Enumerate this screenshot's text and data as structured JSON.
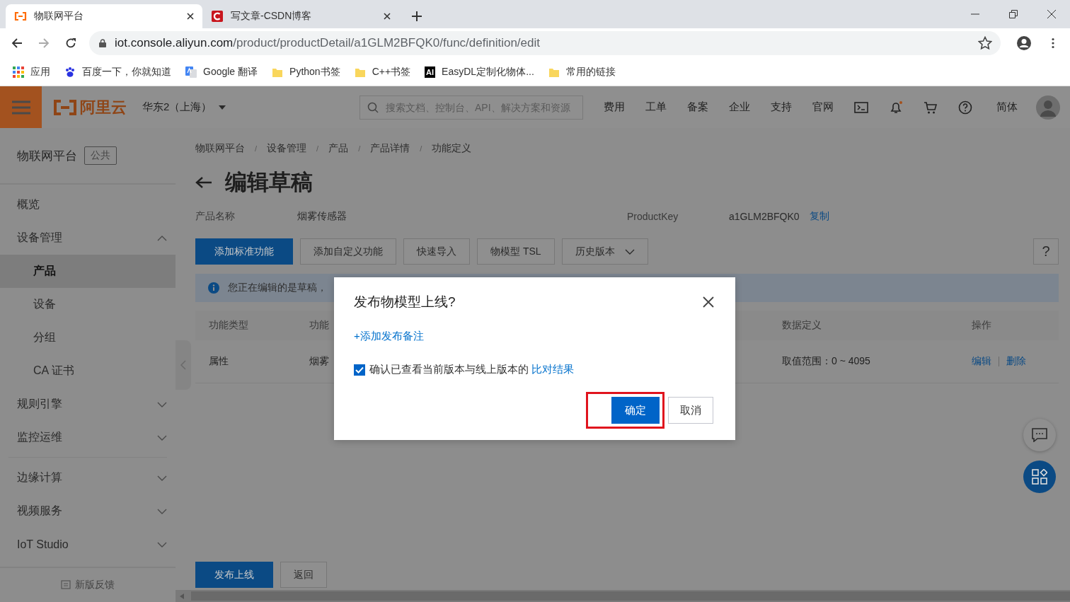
{
  "browser": {
    "tabs": [
      {
        "title": "物联网平台",
        "kind": "aliyun",
        "selected": true
      },
      {
        "title": "写文章-CSDN博客",
        "kind": "csdn",
        "selected": false
      }
    ],
    "url_host": "iot.console.aliyun.com",
    "url_path": "/product/productDetail/a1GLM2BFQK0/func/definition/edit",
    "bookmarks": [
      {
        "label": "应用",
        "kind": "apps"
      },
      {
        "label": "百度一下，你就知道",
        "kind": "paw"
      },
      {
        "label": "Google 翻译",
        "kind": "translate"
      },
      {
        "label": "Python书签",
        "kind": "folder"
      },
      {
        "label": "C++书签",
        "kind": "folder"
      },
      {
        "label": "EasyDL定制化物体...",
        "kind": "badge",
        "icon_text": "AI"
      },
      {
        "label": "常用的链接",
        "kind": "folder"
      }
    ]
  },
  "header": {
    "logo_text": "阿里云",
    "region": "华东2（上海）",
    "search_placeholder": "搜索文档、控制台、API、解决方案和资源",
    "nav": [
      "费用",
      "工单",
      "备案",
      "企业",
      "支持",
      "官网"
    ],
    "notifications_unread": true,
    "language": "简体"
  },
  "sidebar": {
    "title": "物联网平台",
    "tag": "公共",
    "items": [
      {
        "label": "概览",
        "selected": false
      },
      {
        "label": "设备管理",
        "selected": false,
        "expanded": true,
        "children": [
          {
            "label": "产品",
            "selected": true
          },
          {
            "label": "设备",
            "selected": false
          },
          {
            "label": "分组",
            "selected": false
          },
          {
            "label": "CA 证书",
            "selected": false
          }
        ]
      },
      {
        "label": "规则引擎",
        "selected": false,
        "expanded": false
      },
      {
        "label": "监控运维",
        "selected": false,
        "expanded": false
      },
      {
        "label": "边缘计算",
        "selected": false,
        "expanded": false
      },
      {
        "label": "视频服务",
        "selected": false,
        "expanded": false
      },
      {
        "label": "IoT Studio",
        "selected": false,
        "expanded": false
      }
    ],
    "feedback": "新版反馈"
  },
  "main": {
    "breadcrumb": [
      {
        "label": "物联网平台"
      },
      {
        "separator": "/",
        "label": "设备管理"
      },
      {
        "separator": "/",
        "label": "产品"
      },
      {
        "separator": "/",
        "label": "产品详情"
      },
      {
        "separator": "/",
        "label": "功能定义"
      }
    ],
    "title": "编辑草稿",
    "info": [
      {
        "label": "产品名称",
        "value": "烟雾传感器"
      },
      {
        "label": "ProductKey",
        "value": "a1GLM2BFQK0",
        "action": "复制"
      }
    ],
    "toolbar": [
      {
        "label": "添加标准功能",
        "primary": true
      },
      {
        "label": "添加自定义功能",
        "primary": false
      },
      {
        "label": "快速导入",
        "primary": false
      },
      {
        "label": "物模型 TSL",
        "primary": false
      },
      {
        "label": "历史版本",
        "primary": false,
        "dropdown": true
      }
    ],
    "help": "?",
    "notice": "您正在编辑的是草稿，",
    "table": {
      "columns": [
        "功能类型",
        "功能",
        "数据定义",
        "操作"
      ],
      "rows": [
        {
          "cells": [
            "属性",
            "烟雾",
            "取值范围：0 ~ 4095"
          ],
          "actions": [
            "编辑",
            "删除"
          ]
        }
      ]
    },
    "footer_buttons": [
      {
        "label": "发布上线",
        "primary": true
      },
      {
        "label": "返回",
        "primary": false
      }
    ]
  },
  "dialog": {
    "title": "发布物模型上线?",
    "add_note": "+添加发布备注",
    "confirm": {
      "checked": true,
      "text": "确认已查看当前版本与线上版本的",
      "link": "比对结果"
    },
    "buttons": [
      {
        "label": "确定",
        "primary": true,
        "highlighted": true
      },
      {
        "label": "取消",
        "primary": false,
        "highlighted": false
      }
    ]
  }
}
